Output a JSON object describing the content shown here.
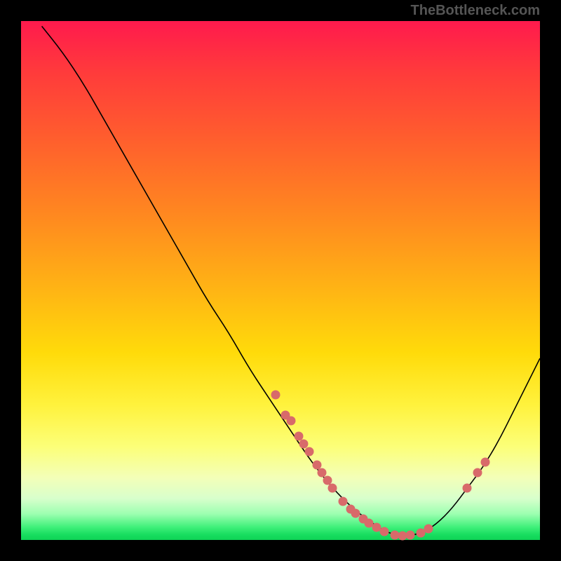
{
  "attribution": "TheBottleneck.com",
  "chart_data": {
    "type": "line",
    "title": "",
    "xlabel": "",
    "ylabel": "",
    "xlim": [
      0,
      100
    ],
    "ylim": [
      0,
      100
    ],
    "curve": [
      {
        "x": 4,
        "y": 99
      },
      {
        "x": 8,
        "y": 94
      },
      {
        "x": 12,
        "y": 88
      },
      {
        "x": 16,
        "y": 81
      },
      {
        "x": 20,
        "y": 74
      },
      {
        "x": 24,
        "y": 67
      },
      {
        "x": 28,
        "y": 60
      },
      {
        "x": 32,
        "y": 53
      },
      {
        "x": 36,
        "y": 46
      },
      {
        "x": 40,
        "y": 40
      },
      {
        "x": 44,
        "y": 33
      },
      {
        "x": 48,
        "y": 27
      },
      {
        "x": 52,
        "y": 21
      },
      {
        "x": 56,
        "y": 15
      },
      {
        "x": 60,
        "y": 10
      },
      {
        "x": 64,
        "y": 6
      },
      {
        "x": 68,
        "y": 3
      },
      {
        "x": 71,
        "y": 1.2
      },
      {
        "x": 74,
        "y": 0.8
      },
      {
        "x": 77,
        "y": 1.2
      },
      {
        "x": 80,
        "y": 3
      },
      {
        "x": 83,
        "y": 6
      },
      {
        "x": 86,
        "y": 10
      },
      {
        "x": 89,
        "y": 14
      },
      {
        "x": 92,
        "y": 19
      },
      {
        "x": 95,
        "y": 25
      },
      {
        "x": 98,
        "y": 31
      },
      {
        "x": 100,
        "y": 35
      }
    ],
    "dots": [
      {
        "x": 49,
        "y": 28
      },
      {
        "x": 51,
        "y": 24
      },
      {
        "x": 52,
        "y": 23
      },
      {
        "x": 53.5,
        "y": 20
      },
      {
        "x": 54.5,
        "y": 18.5
      },
      {
        "x": 55.5,
        "y": 17
      },
      {
        "x": 57,
        "y": 14.5
      },
      {
        "x": 58,
        "y": 13
      },
      {
        "x": 59,
        "y": 11.5
      },
      {
        "x": 60,
        "y": 10
      },
      {
        "x": 62,
        "y": 7.5
      },
      {
        "x": 63.5,
        "y": 6
      },
      {
        "x": 64.5,
        "y": 5.2
      },
      {
        "x": 66,
        "y": 4
      },
      {
        "x": 67,
        "y": 3.2
      },
      {
        "x": 68.5,
        "y": 2.4
      },
      {
        "x": 70,
        "y": 1.6
      },
      {
        "x": 72,
        "y": 1
      },
      {
        "x": 73.5,
        "y": 0.8
      },
      {
        "x": 75,
        "y": 1
      },
      {
        "x": 77,
        "y": 1.4
      },
      {
        "x": 78.5,
        "y": 2.2
      },
      {
        "x": 86,
        "y": 10
      },
      {
        "x": 88,
        "y": 13
      },
      {
        "x": 89.5,
        "y": 15
      }
    ],
    "gradient_note": "vertical red→orange→yellow→green heat gradient behind curve"
  }
}
